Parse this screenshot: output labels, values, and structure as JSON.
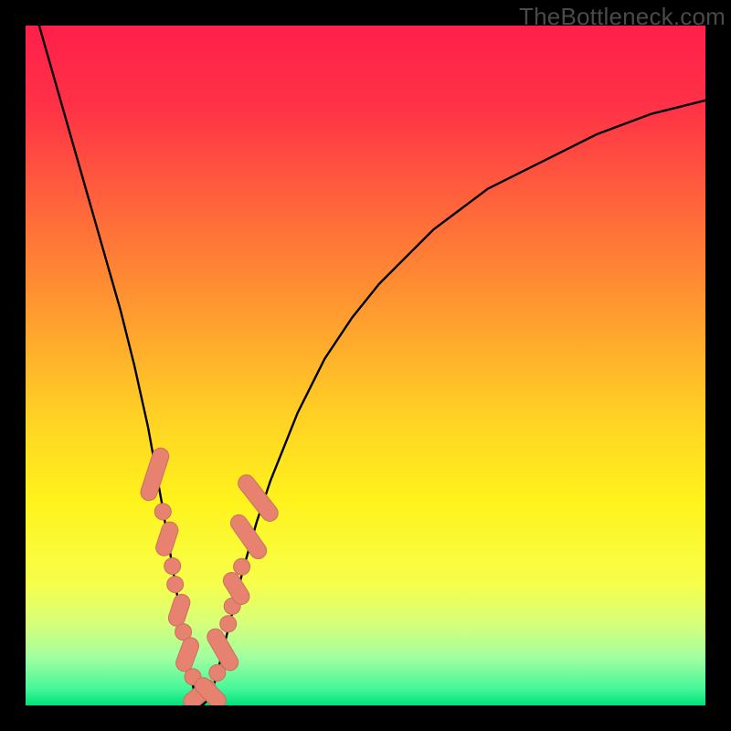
{
  "watermark": "TheBottleneck.com",
  "colors": {
    "gradient_stops": [
      {
        "offset": 0.0,
        "color": "#ff1f4b"
      },
      {
        "offset": 0.12,
        "color": "#ff3246"
      },
      {
        "offset": 0.28,
        "color": "#ff6a3a"
      },
      {
        "offset": 0.44,
        "color": "#ffa12e"
      },
      {
        "offset": 0.58,
        "color": "#ffd324"
      },
      {
        "offset": 0.7,
        "color": "#fff31c"
      },
      {
        "offset": 0.82,
        "color": "#f7ff4a"
      },
      {
        "offset": 0.88,
        "color": "#d6ff7a"
      },
      {
        "offset": 0.93,
        "color": "#a0ffa0"
      },
      {
        "offset": 0.975,
        "color": "#47f79a"
      },
      {
        "offset": 1.0,
        "color": "#00e07a"
      }
    ],
    "curve": "#000000",
    "marker_fill": "#e6826f",
    "marker_stroke": "#c97060",
    "frame": "#000000"
  },
  "chart_data": {
    "type": "line",
    "title": "",
    "xlabel": "",
    "ylabel": "",
    "xlim": [
      0,
      100
    ],
    "ylim": [
      0,
      100
    ],
    "grid": false,
    "legend": false,
    "note": "Bottleneck-style V curve. y represents mismatch/bottleneck percentage (0 at bottom = no bottleneck). x is a relative component-strength axis. Values are read off the plotted curve at roughly even x steps.",
    "series": [
      {
        "name": "bottleneck-curve",
        "x": [
          2,
          4,
          6,
          8,
          10,
          12,
          14,
          16,
          18,
          20,
          21,
          22,
          23,
          24,
          25,
          26,
          27,
          28,
          29,
          30,
          32,
          34,
          36,
          38,
          40,
          44,
          48,
          52,
          56,
          60,
          64,
          68,
          72,
          76,
          80,
          84,
          88,
          92,
          96,
          100
        ],
        "y": [
          100,
          93,
          86,
          79,
          72,
          65,
          58,
          50,
          41,
          30,
          24,
          18,
          12,
          6,
          1,
          0,
          1,
          4,
          8,
          12,
          20,
          27,
          33,
          38,
          43,
          51,
          57,
          62,
          66,
          70,
          73,
          76,
          78,
          80,
          82,
          84,
          85.5,
          87,
          88,
          89
        ]
      }
    ],
    "minimum": {
      "x": 26,
      "y": 0
    },
    "markers_note": "Pink pill/dot markers cluster around the trough of the V between roughly x≈18 and x≈34, y≲30.",
    "markers": [
      {
        "shape": "pill",
        "cx": 19.0,
        "cy": 34.0,
        "angle": -72,
        "len": 5.0
      },
      {
        "shape": "dot",
        "cx": 20.2,
        "cy": 28.5
      },
      {
        "shape": "pill",
        "cx": 20.8,
        "cy": 24.5,
        "angle": -72,
        "len": 3.2
      },
      {
        "shape": "dot",
        "cx": 21.6,
        "cy": 20.5
      },
      {
        "shape": "dot",
        "cx": 22.0,
        "cy": 17.8
      },
      {
        "shape": "pill",
        "cx": 22.6,
        "cy": 14.0,
        "angle": -72,
        "len": 3.0
      },
      {
        "shape": "dot",
        "cx": 23.2,
        "cy": 10.8
      },
      {
        "shape": "pill",
        "cx": 23.8,
        "cy": 7.5,
        "angle": -70,
        "len": 3.2
      },
      {
        "shape": "dot",
        "cx": 24.6,
        "cy": 4.2
      },
      {
        "shape": "pill",
        "cx": 25.6,
        "cy": 1.6,
        "angle": -40,
        "len": 3.4
      },
      {
        "shape": "pill",
        "cx": 27.2,
        "cy": 1.8,
        "angle": 45,
        "len": 3.4
      },
      {
        "shape": "dot",
        "cx": 28.2,
        "cy": 4.8
      },
      {
        "shape": "pill",
        "cx": 29.0,
        "cy": 8.2,
        "angle": 60,
        "len": 4.2
      },
      {
        "shape": "dot",
        "cx": 29.8,
        "cy": 12.0
      },
      {
        "shape": "dot",
        "cx": 30.4,
        "cy": 14.6
      },
      {
        "shape": "pill",
        "cx": 31.0,
        "cy": 17.2,
        "angle": 58,
        "len": 3.2
      },
      {
        "shape": "dot",
        "cx": 31.8,
        "cy": 20.4
      },
      {
        "shape": "pill",
        "cx": 32.8,
        "cy": 24.8,
        "angle": 55,
        "len": 4.6
      },
      {
        "shape": "pill",
        "cx": 34.2,
        "cy": 30.5,
        "angle": 52,
        "len": 5.0
      }
    ]
  }
}
